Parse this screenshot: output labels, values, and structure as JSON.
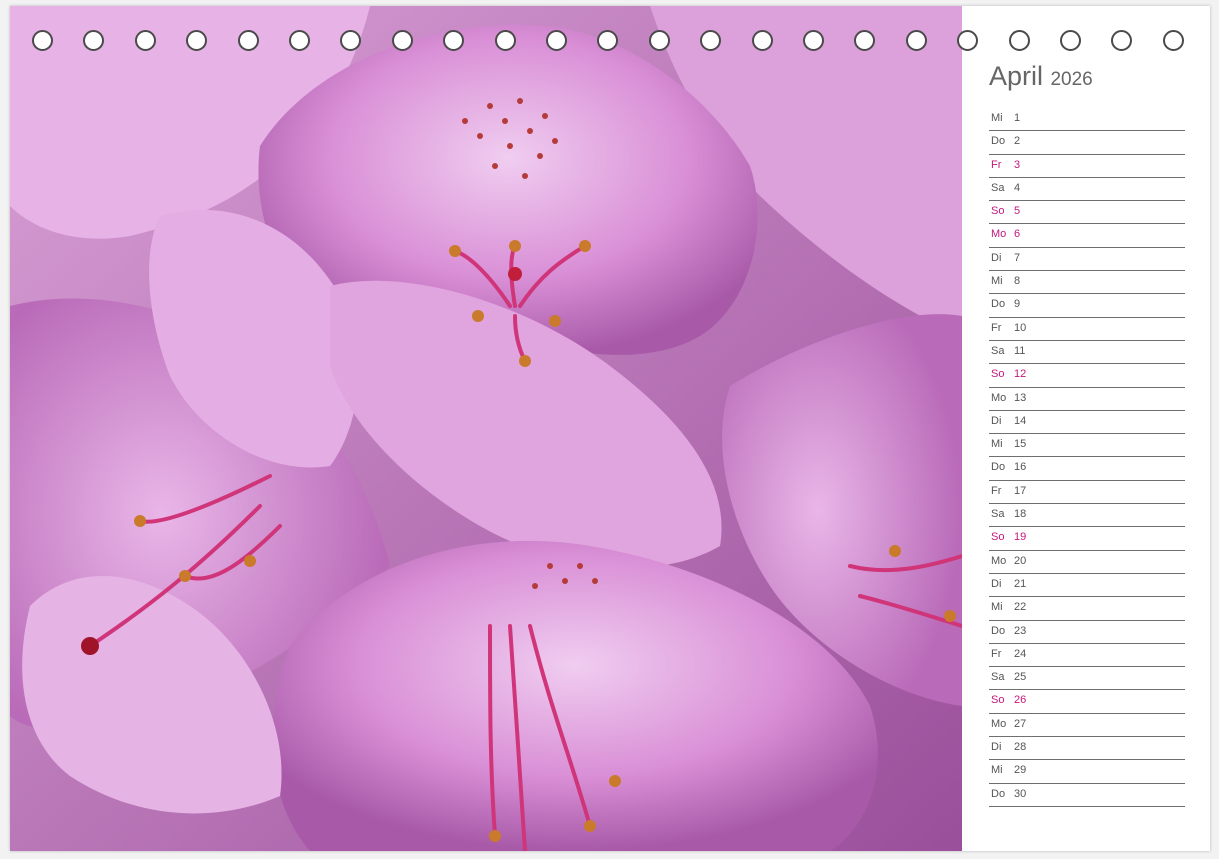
{
  "calendar": {
    "month": "April",
    "year": "2026",
    "accent_color": "#c2187d",
    "days": [
      {
        "wd": "Mi",
        "d": "1",
        "weekend": false
      },
      {
        "wd": "Do",
        "d": "2",
        "weekend": false
      },
      {
        "wd": "Fr",
        "d": "3",
        "weekend": true
      },
      {
        "wd": "Sa",
        "d": "4",
        "weekend": false
      },
      {
        "wd": "So",
        "d": "5",
        "weekend": true
      },
      {
        "wd": "Mo",
        "d": "6",
        "weekend": true
      },
      {
        "wd": "Di",
        "d": "7",
        "weekend": false
      },
      {
        "wd": "Mi",
        "d": "8",
        "weekend": false
      },
      {
        "wd": "Do",
        "d": "9",
        "weekend": false
      },
      {
        "wd": "Fr",
        "d": "10",
        "weekend": false
      },
      {
        "wd": "Sa",
        "d": "11",
        "weekend": false
      },
      {
        "wd": "So",
        "d": "12",
        "weekend": true
      },
      {
        "wd": "Mo",
        "d": "13",
        "weekend": false
      },
      {
        "wd": "Di",
        "d": "14",
        "weekend": false
      },
      {
        "wd": "Mi",
        "d": "15",
        "weekend": false
      },
      {
        "wd": "Do",
        "d": "16",
        "weekend": false
      },
      {
        "wd": "Fr",
        "d": "17",
        "weekend": false
      },
      {
        "wd": "Sa",
        "d": "18",
        "weekend": false
      },
      {
        "wd": "So",
        "d": "19",
        "weekend": true
      },
      {
        "wd": "Mo",
        "d": "20",
        "weekend": false
      },
      {
        "wd": "Di",
        "d": "21",
        "weekend": false
      },
      {
        "wd": "Mi",
        "d": "22",
        "weekend": false
      },
      {
        "wd": "Do",
        "d": "23",
        "weekend": false
      },
      {
        "wd": "Fr",
        "d": "24",
        "weekend": false
      },
      {
        "wd": "Sa",
        "d": "25",
        "weekend": false
      },
      {
        "wd": "So",
        "d": "26",
        "weekend": true
      },
      {
        "wd": "Mo",
        "d": "27",
        "weekend": false
      },
      {
        "wd": "Di",
        "d": "28",
        "weekend": false
      },
      {
        "wd": "Mi",
        "d": "29",
        "weekend": false
      },
      {
        "wd": "Do",
        "d": "30",
        "weekend": false
      }
    ]
  },
  "photo": {
    "subject": "rhododendron-flower-icon",
    "colors": {
      "petal": "#d98fd6",
      "petal_light": "#ecc3ec",
      "petal_dark": "#a85aa8",
      "spots": "#b53a3a",
      "stamen": "#d0357a"
    }
  },
  "binding": {
    "hole_count": 23,
    "icon": "spiral-binding-hole-icon"
  }
}
